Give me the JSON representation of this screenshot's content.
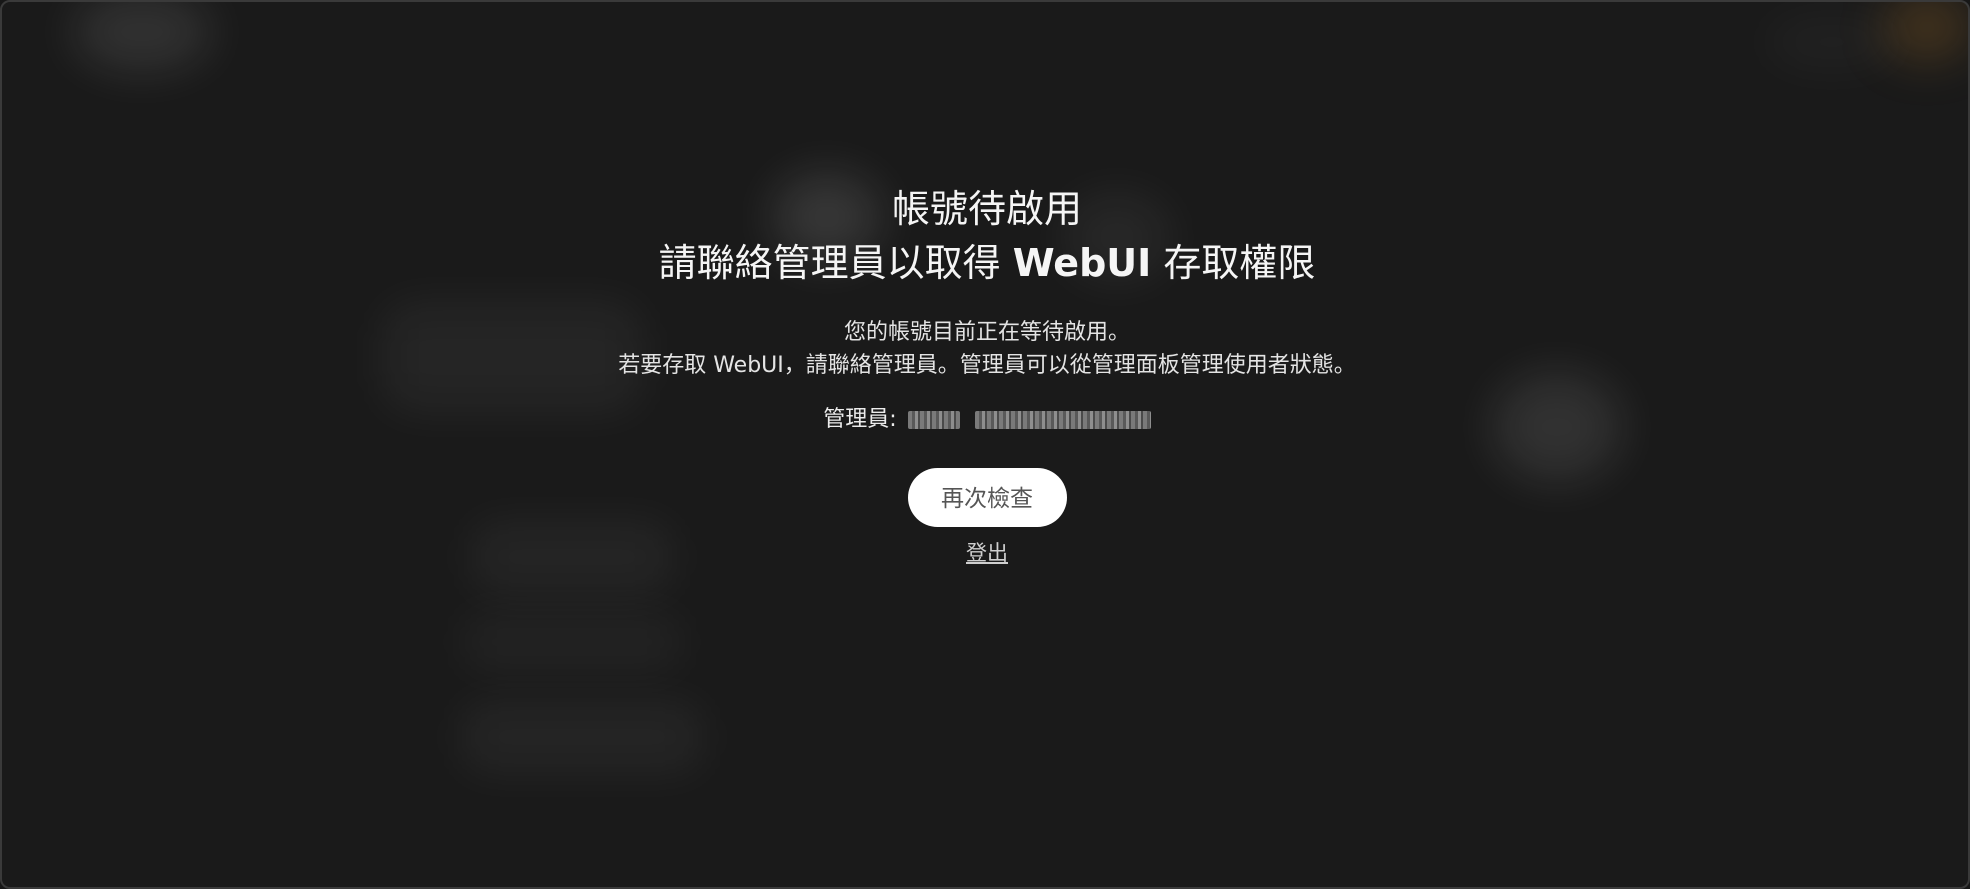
{
  "pending": {
    "title_line1": "帳號待啟用",
    "title_line2_a": "請聯絡管理員以取得 ",
    "title_line2_b": "WebUI",
    "title_line2_c": " 存取權限",
    "desc_line1": "您的帳號目前正在等待啟用。",
    "desc_line2": "若要存取 WebUI，請聯絡管理員。管理員可以從管理面板管理使用者狀態。",
    "admin_label": "管理員:",
    "check_again_label": "再次檢查",
    "sign_out_label": "登出"
  }
}
